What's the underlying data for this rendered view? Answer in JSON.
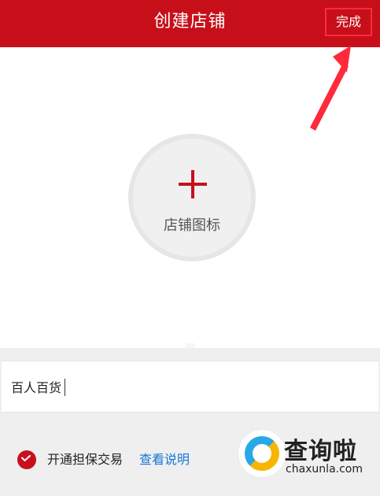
{
  "header": {
    "title": "创建店铺",
    "done_label": "完成"
  },
  "shop_icon": {
    "label": "店铺图标"
  },
  "name_field": {
    "value": "百人百货"
  },
  "guarantee": {
    "checked": true,
    "label": "开通担保交易",
    "link_label": "查看说明"
  },
  "watermark": {
    "brand": "查询啦",
    "domain": "chaxunla.com"
  },
  "colors": {
    "header_bg": "#c70f1a",
    "accent": "#c8101c",
    "link": "#1477d6",
    "annotation": "#ff2a3b"
  }
}
